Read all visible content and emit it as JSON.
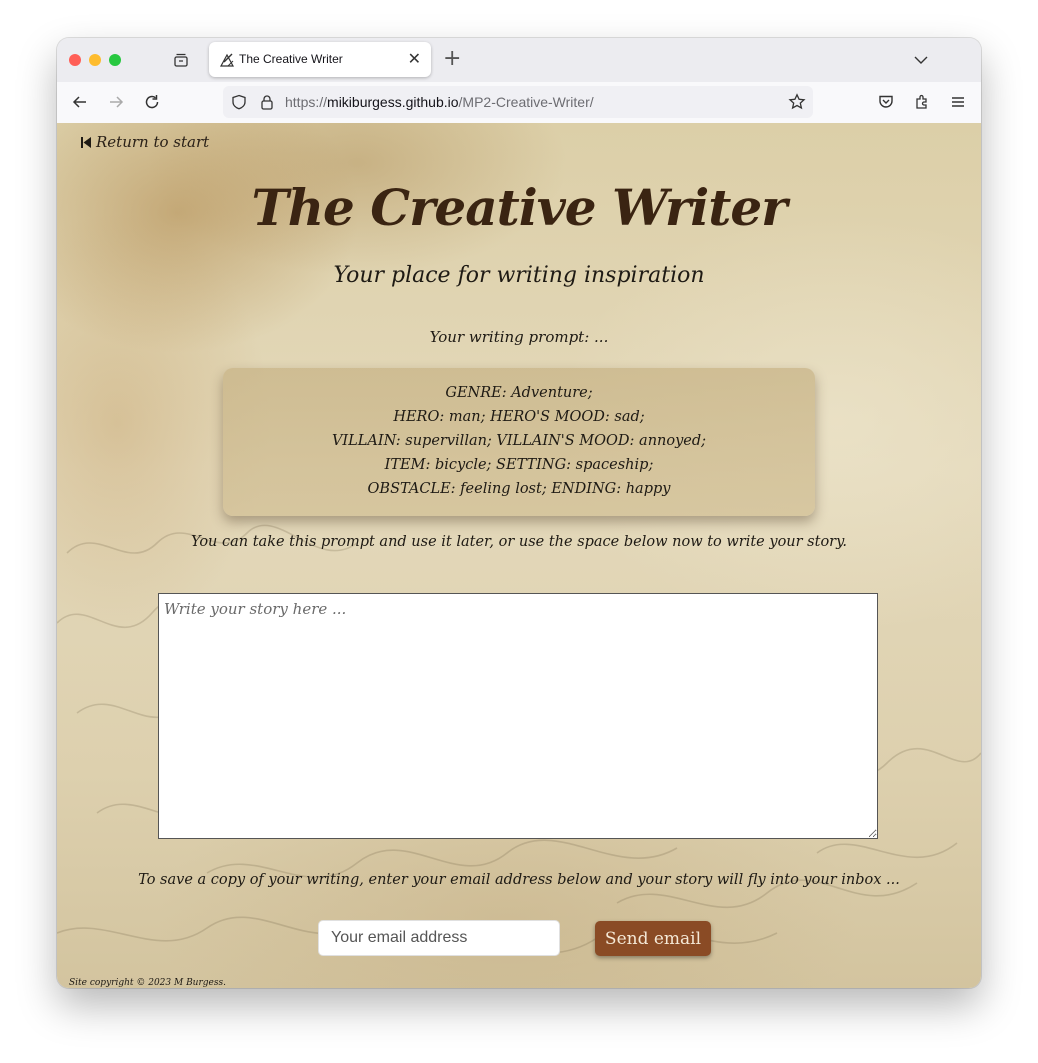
{
  "browser": {
    "tab_title": "The Creative Writer",
    "new_tab_label": "+",
    "close_tab_label": "✕",
    "url_scheme": "https://",
    "url_host": "mikiburgess.github.io",
    "url_path": "/MP2-Creative-Writer/"
  },
  "page": {
    "return_link": "Return to start",
    "title": "The Creative Writer",
    "subtitle": "Your place for writing inspiration",
    "prompt_label": "Your writing prompt: ...",
    "prompt_lines": [
      "GENRE: Adventure;",
      "HERO: man; HERO'S MOOD: sad;",
      "VILLAIN: supervillan; VILLAIN'S MOOD: annoyed;",
      "ITEM: bicycle; SETTING: spaceship;",
      "OBSTACLE: feeling lost; ENDING: happy"
    ],
    "hint": "You can take this prompt and use it later, or use the space below now to write your story.",
    "story_placeholder": "Write your story here ...",
    "save_text": "To save a copy of your writing, enter your email address below and your story will fly into your inbox ...",
    "email_placeholder": "Your email address",
    "send_button": "Send email",
    "copyright": "Site copyright © 2023 M Burgess."
  },
  "colors": {
    "title": "#3a2412",
    "button_bg": "#8a4b25",
    "button_text": "#f4e8d6",
    "parchment": "#dccfa8"
  }
}
